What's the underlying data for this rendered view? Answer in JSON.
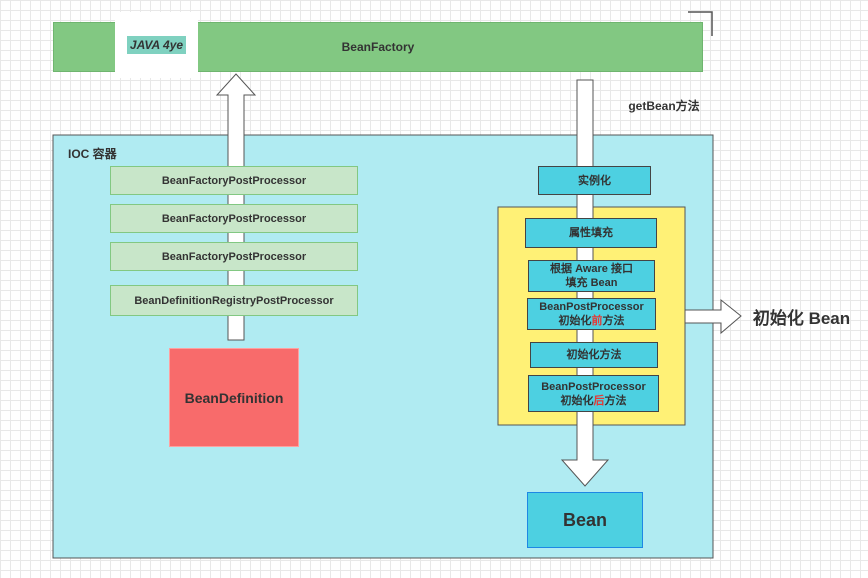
{
  "bean_factory": {
    "label": "BeanFactory",
    "color": "#82c882"
  },
  "logo": {
    "text": "JAVA 4ye"
  },
  "get_bean_label": "getBean方法",
  "ioc": {
    "label": "IOC 容器",
    "color": "#b0ebf2"
  },
  "post_processors": [
    "BeanFactoryPostProcessor",
    "BeanFactoryPostProcessor",
    "BeanFactoryPostProcessor",
    "BeanDefinitionRegistryPostProcessor"
  ],
  "bean_definition": {
    "label": "BeanDefinition",
    "color": "#f86b6b"
  },
  "instantiate": "实例化",
  "steps": {
    "populate": "属性填充",
    "aware_1": "根据 Aware 接口",
    "aware_2": "填充 Bean",
    "before_1": "BeanPostProcessor",
    "before_2a": "初始化",
    "before_2b": "前",
    "before_2c": "方法",
    "init": "初始化方法",
    "after_1": "BeanPostProcessor",
    "after_2a": "初始化",
    "after_2b": "后",
    "after_2c": "方法"
  },
  "init_bean_label": "初始化 Bean",
  "bean": {
    "label": "Bean"
  }
}
